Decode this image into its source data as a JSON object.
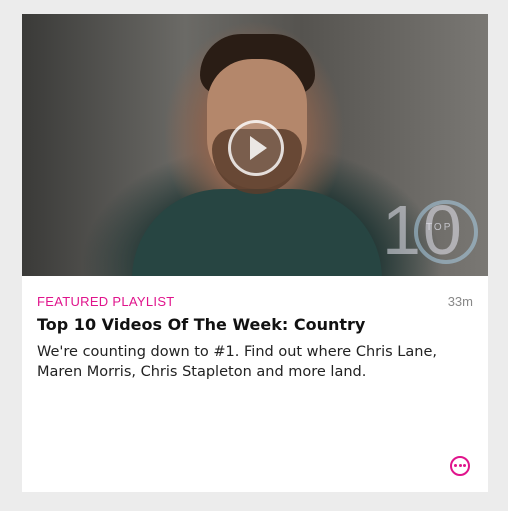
{
  "card": {
    "category_label": "FEATURED PLAYLIST",
    "duration": "33m",
    "title": "Top 10 Videos Of The Week: Country",
    "description": "We're counting down to #1. Find out where Chris Lane, Maren Morris, Chris Stapleton and more land.",
    "badge_number": "10",
    "badge_text": "TOP"
  },
  "icons": {
    "play": "play-icon",
    "more": "more-options-icon"
  },
  "colors": {
    "accent": "#e0148c",
    "background": "#ececec",
    "card": "#ffffff"
  }
}
